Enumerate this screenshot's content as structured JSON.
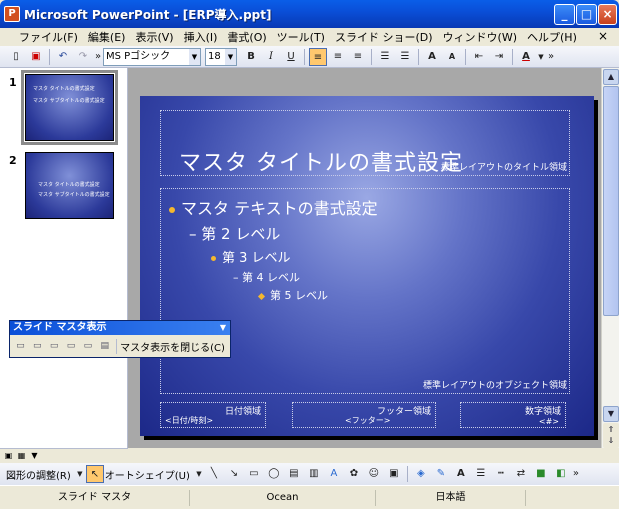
{
  "window": {
    "title": "Microsoft PowerPoint - [ERP導入.ppt]",
    "app_icon": "powerpoint-icon"
  },
  "menu": {
    "items": [
      "ファイル(F)",
      "編集(E)",
      "表示(V)",
      "挿入(I)",
      "書式(O)",
      "ツール(T)",
      "スライド ショー(D)",
      "ウィンドウ(W)",
      "ヘルプ(H)"
    ],
    "close": "×"
  },
  "toolbar": {
    "font_name": "MS Pゴシック",
    "font_size": "18",
    "bold": "B",
    "italic": "I",
    "underline": "U",
    "grow_font": "A",
    "font_color": "A"
  },
  "thumbnails": {
    "items": [
      {
        "num": "1",
        "title": "マスタ タイトルの書式設定",
        "sub": "マスタ サブタイトルの書式設定"
      },
      {
        "num": "2",
        "title": "マスタ タイトルの書式設定",
        "sub": "マスタ サブタイトルの書式設定"
      }
    ]
  },
  "slide": {
    "title": "マスタ タイトルの書式設定",
    "title_area_label": "標準レイアウトのタイトル領域",
    "levels": [
      "マスタ テキストの書式設定",
      "第 2 レベル",
      "第 3 レベル",
      "第 4 レベル",
      "第 5 レベル"
    ],
    "level_prefix": [
      "",
      "–",
      "",
      "–",
      ""
    ],
    "object_area_label": "標準レイアウトのオブジェクト領域",
    "date_label": "日付領域",
    "date_value": "<日付/時刻>",
    "footer_label": "フッター領域",
    "footer_value": "<フッター>",
    "number_label": "数字領域",
    "number_value": "<#>"
  },
  "floating_toolbar": {
    "title": "スライド マスタ表示",
    "close_label": "マスタ表示を閉じる(C)"
  },
  "drawing_toolbar": {
    "draw_label": "図形の調整(R)",
    "autoshape_label": "オートシェイプ(U)"
  },
  "status": {
    "view": "スライド マスタ",
    "design": "Ocean",
    "language": "日本語"
  },
  "colors": {
    "bullet": "#f5b82e",
    "titlebar": "#0a4fd8"
  }
}
